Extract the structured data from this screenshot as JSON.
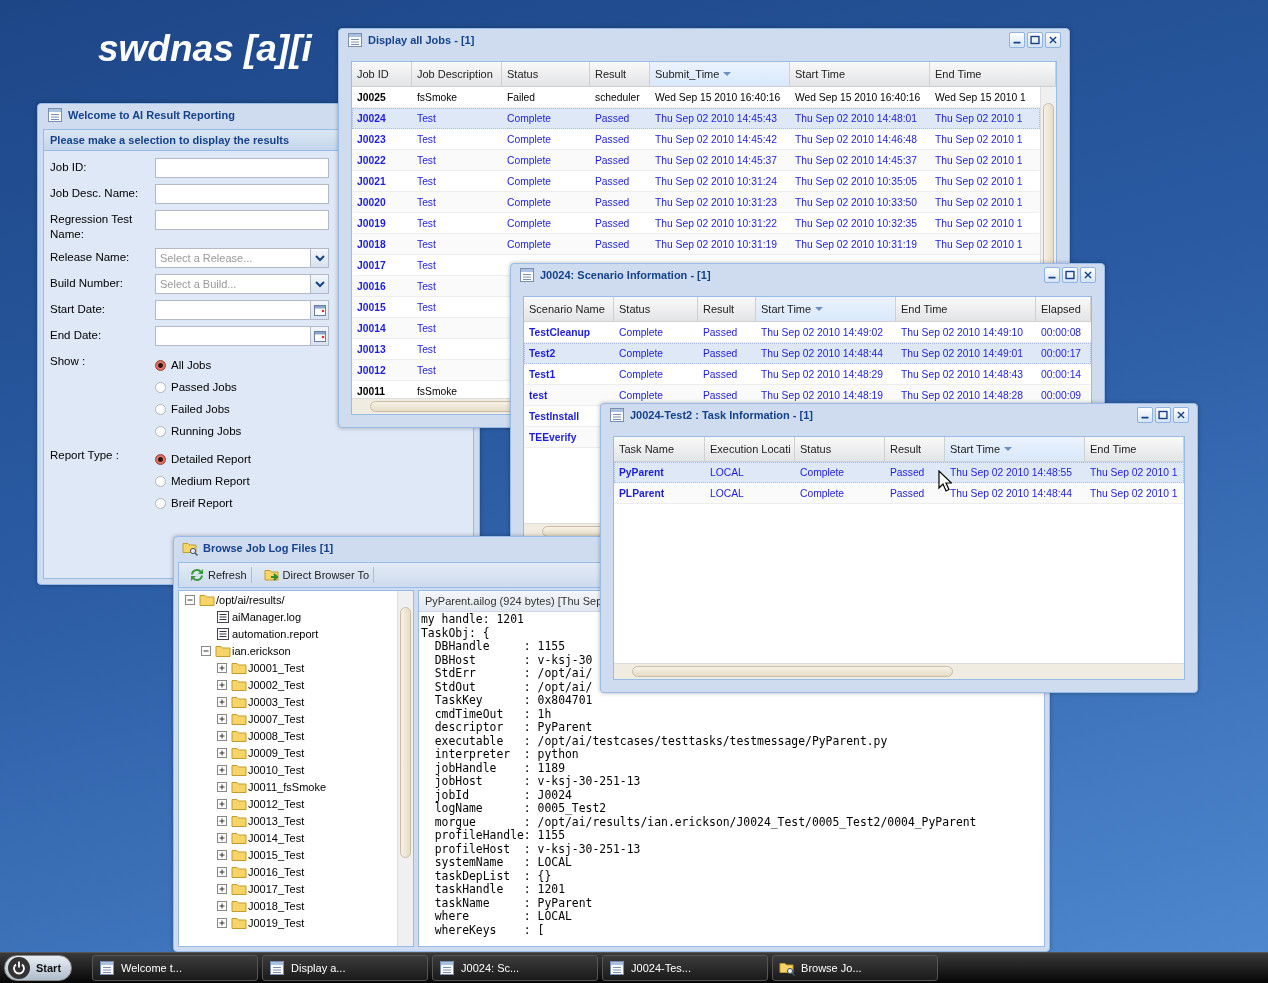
{
  "desktop_title": "swdnas [a][i",
  "windows": [
    {
      "kind": "form",
      "title": "Welcome to AI Result Reporting",
      "subtitle": "Please make a selection to display the results",
      "fields": [
        {
          "kind": "text",
          "label": "Job ID:"
        },
        {
          "kind": "text",
          "label": "Job Desc. Name:"
        },
        {
          "kind": "text",
          "label": "Regression Test Name:"
        },
        {
          "kind": "combo",
          "label": "Release Name:",
          "placeholder": "Select a Release..."
        },
        {
          "kind": "combo",
          "label": "Build Number:",
          "placeholder": "Select a Build..."
        },
        {
          "kind": "date",
          "label": "Start Date:"
        },
        {
          "kind": "date",
          "label": "End Date:"
        },
        {
          "kind": "radio",
          "label": "Show :",
          "options": [
            {
              "label": "All Jobs",
              "selected": true
            },
            {
              "label": "Passed Jobs",
              "selected": false
            },
            {
              "label": "Failed Jobs",
              "selected": false
            },
            {
              "label": "Running Jobs",
              "selected": false
            }
          ]
        },
        {
          "kind": "radio",
          "label": "Report Type :",
          "options": [
            {
              "label": "Detailed Report",
              "selected": true
            },
            {
              "label": "Medium Report",
              "selected": false
            },
            {
              "label": "Breif Report",
              "selected": false
            }
          ]
        }
      ]
    },
    {
      "kind": "grid",
      "title": "Display all Jobs - [1]",
      "columns": [
        {
          "label": "Job ID",
          "sorted": false
        },
        {
          "label": "Job Description",
          "sorted": false
        },
        {
          "label": "Status",
          "sorted": false
        },
        {
          "label": "Result",
          "sorted": false
        },
        {
          "label": "Submit_Time",
          "sorted": true
        },
        {
          "label": "Start Time",
          "sorted": false
        },
        {
          "label": "End Time",
          "sorted": false
        }
      ],
      "rows": [
        {
          "kind": "failed",
          "selected": false,
          "cells": [
            "J0025",
            "fsSmoke",
            "Failed",
            "scheduler",
            "Wed Sep 15 2010 16:40:16",
            "Wed Sep 15 2010 16:40:16",
            "Wed Sep 15 2010 1"
          ]
        },
        {
          "kind": "passed",
          "selected": true,
          "cells": [
            "J0024",
            "Test",
            "Complete",
            "Passed",
            "Thu Sep 02 2010 14:45:43",
            "Thu Sep 02 2010 14:48:01",
            "Thu Sep 02 2010 1"
          ]
        },
        {
          "kind": "passed",
          "selected": false,
          "cells": [
            "J0023",
            "Test",
            "Complete",
            "Passed",
            "Thu Sep 02 2010 14:45:42",
            "Thu Sep 02 2010 14:46:48",
            "Thu Sep 02 2010 1"
          ]
        },
        {
          "kind": "passed",
          "selected": false,
          "cells": [
            "J0022",
            "Test",
            "Complete",
            "Passed",
            "Thu Sep 02 2010 14:45:37",
            "Thu Sep 02 2010 14:45:37",
            "Thu Sep 02 2010 1"
          ]
        },
        {
          "kind": "passed",
          "selected": false,
          "cells": [
            "J0021",
            "Test",
            "Complete",
            "Passed",
            "Thu Sep 02 2010 10:31:24",
            "Thu Sep 02 2010 10:35:05",
            "Thu Sep 02 2010 1"
          ]
        },
        {
          "kind": "passed",
          "selected": false,
          "cells": [
            "J0020",
            "Test",
            "Complete",
            "Passed",
            "Thu Sep 02 2010 10:31:23",
            "Thu Sep 02 2010 10:33:50",
            "Thu Sep 02 2010 1"
          ]
        },
        {
          "kind": "passed",
          "selected": false,
          "cells": [
            "J0019",
            "Test",
            "Complete",
            "Passed",
            "Thu Sep 02 2010 10:31:22",
            "Thu Sep 02 2010 10:32:35",
            "Thu Sep 02 2010 1"
          ]
        },
        {
          "kind": "passed",
          "selected": false,
          "cells": [
            "J0018",
            "Test",
            "Complete",
            "Passed",
            "Thu Sep 02 2010 10:31:19",
            "Thu Sep 02 2010 10:31:19",
            "Thu Sep 02 2010 1"
          ]
        },
        {
          "kind": "passed",
          "selected": false,
          "cells": [
            "J0017",
            "Test"
          ]
        },
        {
          "kind": "passed",
          "selected": false,
          "cells": [
            "J0016",
            "Test"
          ]
        },
        {
          "kind": "passed",
          "selected": false,
          "cells": [
            "J0015",
            "Test"
          ]
        },
        {
          "kind": "passed",
          "selected": false,
          "cells": [
            "J0014",
            "Test"
          ]
        },
        {
          "kind": "passed",
          "selected": false,
          "cells": [
            "J0013",
            "Test"
          ]
        },
        {
          "kind": "passed",
          "selected": false,
          "cells": [
            "J0012",
            "Test"
          ]
        },
        {
          "kind": "failed",
          "selected": false,
          "cells": [
            "J0011",
            "fsSmoke"
          ]
        }
      ]
    },
    {
      "kind": "grid",
      "title": "J0024: Scenario Information - [1]",
      "columns": [
        {
          "label": "Scenario Name",
          "sorted": false
        },
        {
          "label": "Status",
          "sorted": false
        },
        {
          "label": "Result",
          "sorted": false
        },
        {
          "label": "Start Time",
          "sorted": true
        },
        {
          "label": "End Time",
          "sorted": false
        },
        {
          "label": "Elapsed",
          "sorted": false
        }
      ],
      "rows": [
        {
          "kind": "passed",
          "selected": false,
          "cells": [
            "TestCleanup",
            "Complete",
            "Passed",
            "Thu Sep 02 2010 14:49:02",
            "Thu Sep 02 2010 14:49:10",
            "00:00:08"
          ]
        },
        {
          "kind": "passed",
          "selected": true,
          "cells": [
            "Test2",
            "Complete",
            "Passed",
            "Thu Sep 02 2010 14:48:44",
            "Thu Sep 02 2010 14:49:01",
            "00:00:17"
          ]
        },
        {
          "kind": "passed",
          "selected": false,
          "cells": [
            "Test1",
            "Complete",
            "Passed",
            "Thu Sep 02 2010 14:48:29",
            "Thu Sep 02 2010 14:48:43",
            "00:00:14"
          ]
        },
        {
          "kind": "passed",
          "selected": false,
          "cells": [
            "test",
            "Complete",
            "Passed",
            "Thu Sep 02 2010 14:48:19",
            "Thu Sep 02 2010 14:48:28",
            "00:00:09"
          ]
        },
        {
          "kind": "passed",
          "selected": false,
          "cells": [
            "TestInstall"
          ]
        },
        {
          "kind": "passed",
          "selected": false,
          "cells": [
            "TEEverify"
          ]
        }
      ]
    },
    {
      "kind": "browser",
      "title": "Browse Job Log Files [1]",
      "toolbar": [
        {
          "kind": "refresh",
          "label": "Refresh"
        },
        {
          "kind": "redirect",
          "label": "Direct Browser To"
        }
      ],
      "tree": [
        {
          "kind": "folder",
          "label": "/opt/ai/results/",
          "expanded": true,
          "children": [
            {
              "kind": "file",
              "label": "aiManager.log"
            },
            {
              "kind": "file",
              "label": "automation.report"
            },
            {
              "kind": "folder",
              "label": "ian.erickson",
              "expanded": true,
              "children": [
                {
                  "kind": "folder",
                  "label": "J0001_Test",
                  "expanded": false
                },
                {
                  "kind": "folder",
                  "label": "J0002_Test",
                  "expanded": false
                },
                {
                  "kind": "folder",
                  "label": "J0003_Test",
                  "expanded": false
                },
                {
                  "kind": "folder",
                  "label": "J0007_Test",
                  "expanded": false
                },
                {
                  "kind": "folder",
                  "label": "J0008_Test",
                  "expanded": false
                },
                {
                  "kind": "folder",
                  "label": "J0009_Test",
                  "expanded": false
                },
                {
                  "kind": "folder",
                  "label": "J0010_Test",
                  "expanded": false
                },
                {
                  "kind": "folder",
                  "label": "J0011_fsSmoke",
                  "expanded": false
                },
                {
                  "kind": "folder",
                  "label": "J0012_Test",
                  "expanded": false
                },
                {
                  "kind": "folder",
                  "label": "J0013_Test",
                  "expanded": false
                },
                {
                  "kind": "folder",
                  "label": "J0014_Test",
                  "expanded": false
                },
                {
                  "kind": "folder",
                  "label": "J0015_Test",
                  "expanded": false
                },
                {
                  "kind": "folder",
                  "label": "J0016_Test",
                  "expanded": false
                },
                {
                  "kind": "folder",
                  "label": "J0017_Test",
                  "expanded": false
                },
                {
                  "kind": "folder",
                  "label": "J0018_Test",
                  "expanded": false
                },
                {
                  "kind": "folder",
                  "label": "J0019_Test",
                  "expanded": false
                }
              ]
            }
          ]
        }
      ],
      "log_title": "PyParent.ailog (924 bytes) [Thu Sep",
      "log_lines": [
        "my handle: 1201",
        "TaskObj: {",
        "  DBHandle     : 1155",
        "  DBHost       : v-ksj-30",
        "  StdErr       : /opt/ai/",
        "  StdOut       : /opt/ai/",
        "  TaskKey      : 0x804701",
        "  cmdTimeOut   : 1h",
        "  descriptor   : PyParent",
        "  executable   : /opt/ai/testcases/testtasks/testmessage/PyParent.py",
        "  interpreter  : python",
        "  jobHandle    : 1189",
        "  jobHost      : v-ksj-30-251-13",
        "  jobId        : J0024",
        "  logName      : 0005_Test2",
        "  morgue       : /opt/ai/results/ian.erickson/J0024_Test/0005_Test2/0004_PyParent",
        "  profileHandle: 1155",
        "  profileHost  : v-ksj-30-251-13",
        "  systemName   : LOCAL",
        "  taskDepList  : {}",
        "  taskHandle   : 1201",
        "  taskName     : PyParent",
        "  where        : LOCAL",
        "  whereKeys    : ["
      ]
    },
    {
      "kind": "grid",
      "title": "J0024-Test2 : Task Information - [1]",
      "columns": [
        {
          "label": "Task Name",
          "sorted": false
        },
        {
          "label": "Execution Locati",
          "sorted": false
        },
        {
          "label": "Status",
          "sorted": false
        },
        {
          "label": "Result",
          "sorted": false
        },
        {
          "label": "Start Time",
          "sorted": true
        },
        {
          "label": "End Time",
          "sorted": false
        }
      ],
      "rows": [
        {
          "kind": "passed",
          "selected": true,
          "cells": [
            "PyParent",
            "LOCAL",
            "Complete",
            "Passed",
            "Thu Sep 02 2010 14:48:55",
            "Thu Sep 02 2010 1"
          ]
        },
        {
          "kind": "passed",
          "selected": false,
          "cells": [
            "PLParent",
            "LOCAL",
            "Complete",
            "Passed",
            "Thu Sep 02 2010 14:48:44",
            "Thu Sep 02 2010 1"
          ]
        }
      ]
    }
  ],
  "taskbar": {
    "start": "Start",
    "tasks": [
      {
        "kind": "window",
        "label": "Welcome t..."
      },
      {
        "kind": "window",
        "label": "Display a..."
      },
      {
        "kind": "window",
        "label": "J0024: Sc..."
      },
      {
        "kind": "window",
        "label": "J0024-Tes..."
      },
      {
        "kind": "folder",
        "label": "Browse Jo..."
      }
    ]
  }
}
